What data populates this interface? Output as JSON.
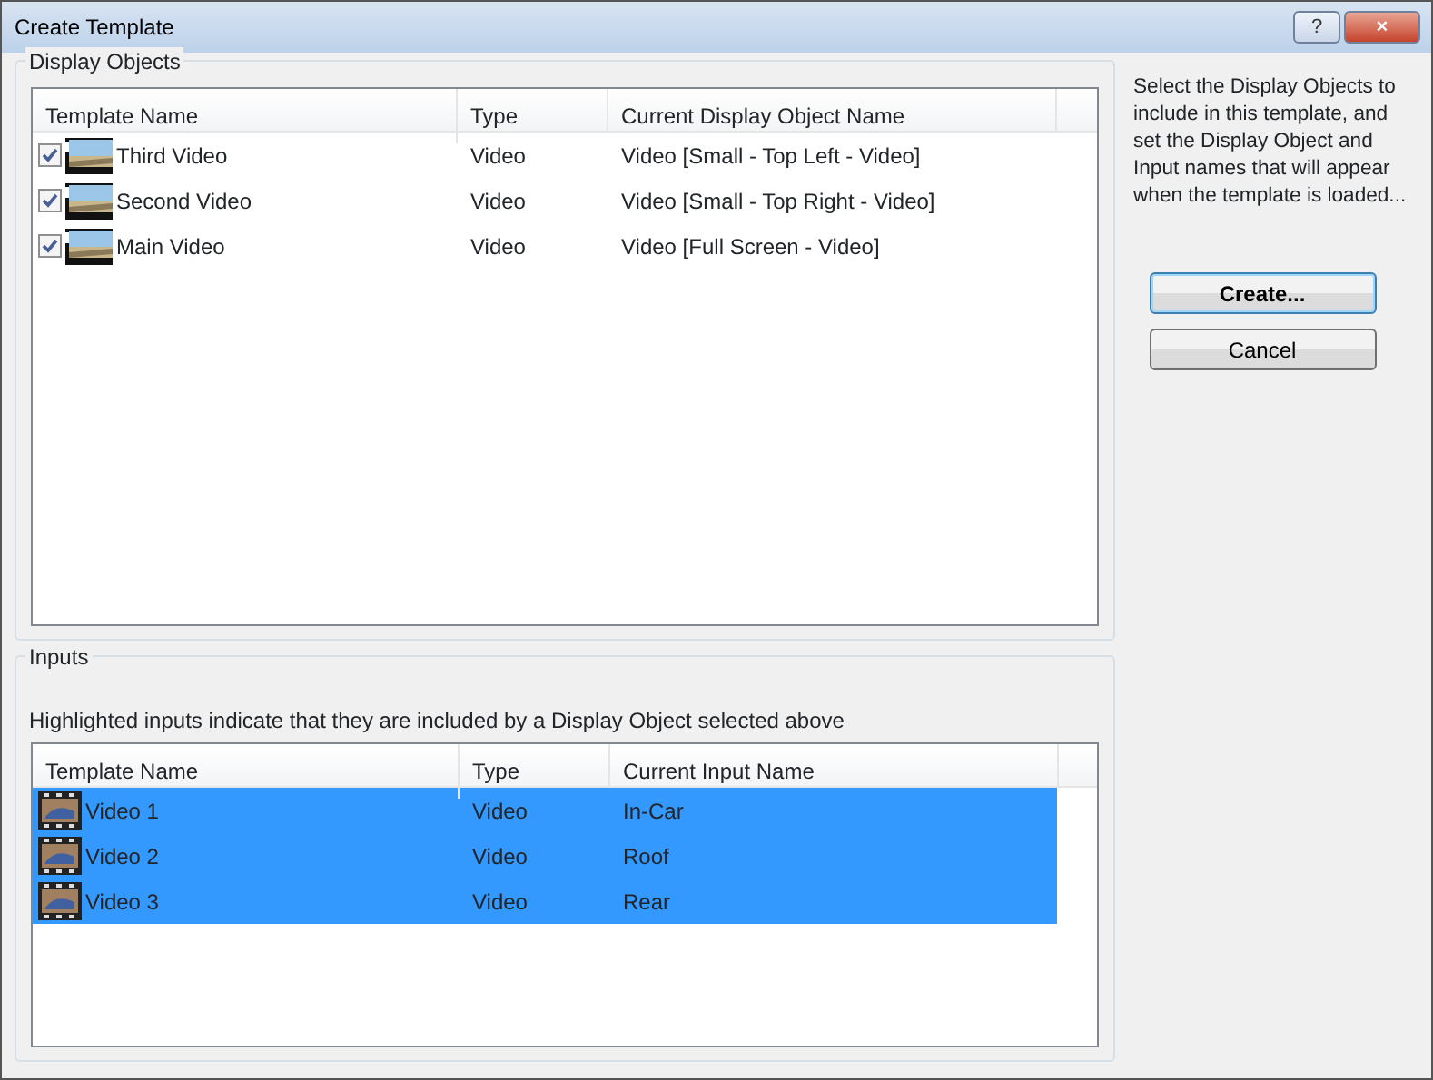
{
  "window": {
    "title": "Create Template",
    "buttons": [
      "?",
      "×"
    ]
  },
  "display_objects": {
    "title": "Display Objects",
    "columns": [
      "Template Name",
      "Type",
      "Current Display Object Name"
    ],
    "rows": [
      {
        "name": "Third Video",
        "type": "Video",
        "current": "Video [Small - Top Left - Video]",
        "checked": true
      },
      {
        "name": "Second Video",
        "type": "Video",
        "current": "Video [Small - Top Right - Video]",
        "checked": true
      },
      {
        "name": "Main Video",
        "type": "Video",
        "current": "Video [Full Screen - Video]",
        "checked": true
      }
    ]
  },
  "inputs": {
    "title": "Inputs",
    "hint": "Highlighted inputs indicate that they are included by a Display Object selected above",
    "columns": [
      "Template Name",
      "Type",
      "Current Input Name"
    ],
    "rows": [
      {
        "name": "Video 1",
        "type": "Video",
        "current": "In-Car",
        "selected": true
      },
      {
        "name": "Video 2",
        "type": "Video",
        "current": "Roof",
        "selected": true
      },
      {
        "name": "Video 3",
        "type": "Video",
        "current": "Rear",
        "selected": true
      }
    ]
  },
  "help_text": "Select the Display Objects to include in this template, and set the Display Object and Input names that will appear when the template is loaded...",
  "buttons": [
    {
      "label": "Create...",
      "default": true
    },
    {
      "label": "Cancel",
      "default": false
    }
  ]
}
